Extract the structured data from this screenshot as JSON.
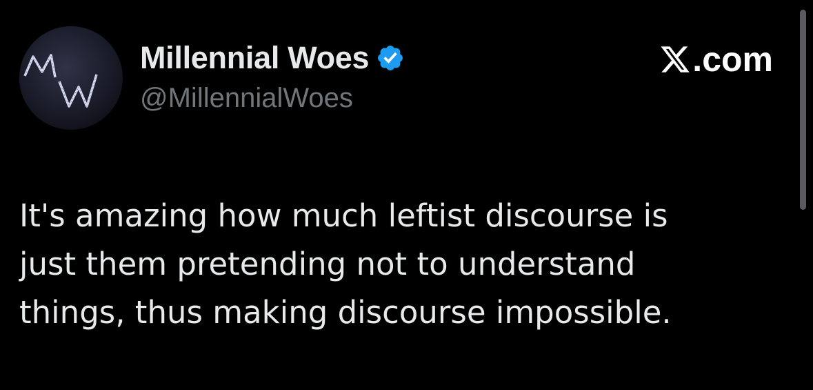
{
  "author": {
    "display_name": "Millennial Woes",
    "handle": "@MillennialWoes",
    "avatar_monogram": "MW",
    "verified_icon": "verified-badge-icon"
  },
  "brand": {
    "site_label": ".com",
    "logo_icon": "x-logo-icon"
  },
  "tweet": {
    "lines": [
      "It's amazing how much leftist discourse is",
      "just them pretending not to understand",
      "things, thus making discourse impossible."
    ]
  },
  "colors": {
    "background": "#000000",
    "primary_text": "#e7e9ea",
    "secondary_text": "#71767b",
    "verified_blue": "#1d9bf0"
  }
}
